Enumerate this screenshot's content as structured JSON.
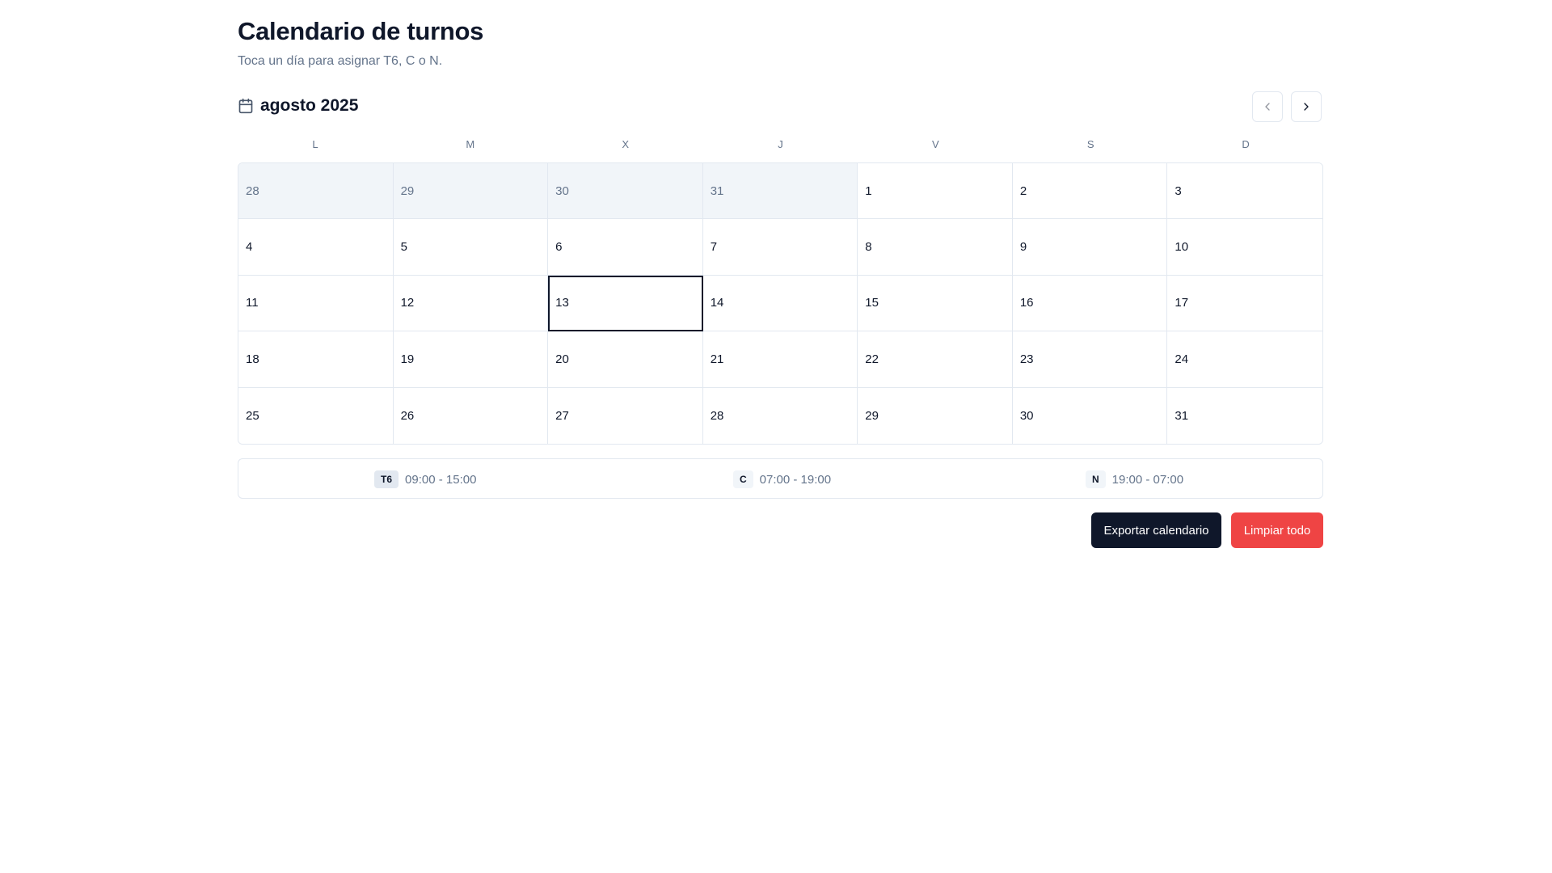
{
  "header": {
    "title": "Calendario de turnos",
    "subtitle": "Toca un día para asignar T6, C o N."
  },
  "calendar": {
    "icon": "calendar-icon",
    "month_label": "agosto 2025",
    "prev_icon": "chevron-left-icon",
    "next_icon": "chevron-right-icon",
    "weekdays": [
      "L",
      "M",
      "X",
      "J",
      "V",
      "S",
      "D"
    ],
    "today": "13",
    "days": [
      {
        "label": "28",
        "outside": true
      },
      {
        "label": "29",
        "outside": true
      },
      {
        "label": "30",
        "outside": true
      },
      {
        "label": "31",
        "outside": true
      },
      {
        "label": "1",
        "outside": false
      },
      {
        "label": "2",
        "outside": false
      },
      {
        "label": "3",
        "outside": false
      },
      {
        "label": "4",
        "outside": false
      },
      {
        "label": "5",
        "outside": false
      },
      {
        "label": "6",
        "outside": false
      },
      {
        "label": "7",
        "outside": false
      },
      {
        "label": "8",
        "outside": false
      },
      {
        "label": "9",
        "outside": false
      },
      {
        "label": "10",
        "outside": false
      },
      {
        "label": "11",
        "outside": false
      },
      {
        "label": "12",
        "outside": false
      },
      {
        "label": "13",
        "outside": false
      },
      {
        "label": "14",
        "outside": false
      },
      {
        "label": "15",
        "outside": false
      },
      {
        "label": "16",
        "outside": false
      },
      {
        "label": "17",
        "outside": false
      },
      {
        "label": "18",
        "outside": false
      },
      {
        "label": "19",
        "outside": false
      },
      {
        "label": "20",
        "outside": false
      },
      {
        "label": "21",
        "outside": false
      },
      {
        "label": "22",
        "outside": false
      },
      {
        "label": "23",
        "outside": false
      },
      {
        "label": "24",
        "outside": false
      },
      {
        "label": "25",
        "outside": false
      },
      {
        "label": "26",
        "outside": false
      },
      {
        "label": "27",
        "outside": false
      },
      {
        "label": "28",
        "outside": false
      },
      {
        "label": "29",
        "outside": false
      },
      {
        "label": "30",
        "outside": false
      },
      {
        "label": "31",
        "outside": false
      }
    ]
  },
  "legend": [
    {
      "code": "T6",
      "time": "09:00 - 15:00",
      "badge_color": "#e2e8f0"
    },
    {
      "code": "C",
      "time": "07:00 - 19:00",
      "badge_color": "#f1f5f9"
    },
    {
      "code": "N",
      "time": "19:00 - 07:00",
      "badge_color": "#f1f5f9"
    }
  ],
  "actions": {
    "export_label": "Exportar calendario",
    "clear_label": "Limpiar todo"
  },
  "colors": {
    "primary": "#0f172a",
    "danger": "#ef4444",
    "muted_text": "#64748b",
    "border": "#e2e8f0",
    "outside_day_bg": "#f1f5f9"
  }
}
